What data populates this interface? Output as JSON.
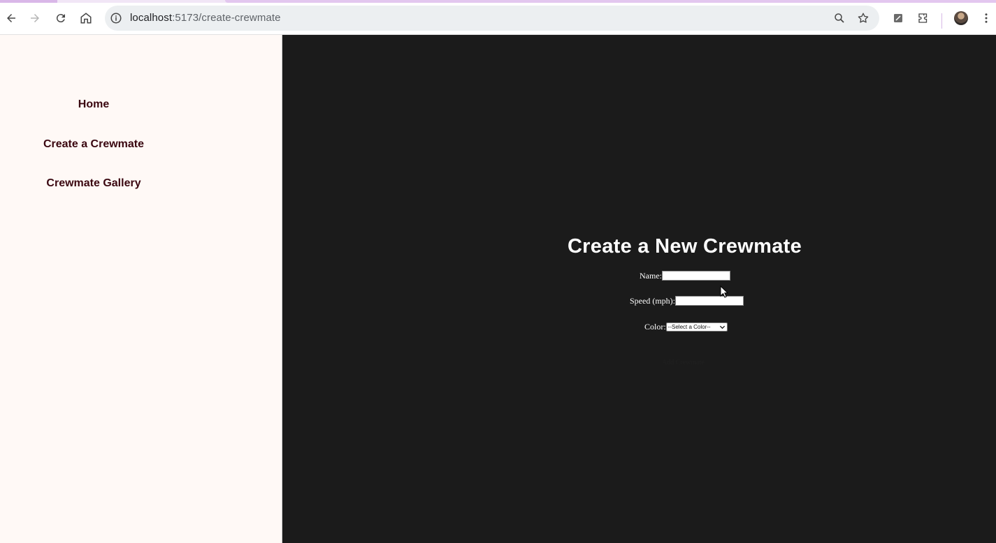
{
  "browser": {
    "url_host": "localhost",
    "url_path": ":5173/create-crewmate",
    "icons": [
      "back-icon",
      "forward-icon",
      "reload-icon",
      "home-icon",
      "info-icon",
      "zoom-icon",
      "star-icon",
      "extension-icon",
      "puzzle-icon",
      "avatar",
      "more-icon"
    ]
  },
  "sidebar": {
    "items": [
      {
        "label": "Home"
      },
      {
        "label": "Create a Crewmate"
      },
      {
        "label": "Crewmate Gallery"
      }
    ]
  },
  "form": {
    "title": "Create a New Crewmate",
    "name_label": "Name:",
    "name_value": "",
    "speed_label": "Speed (mph):",
    "speed_value": "",
    "color_label": "Color:",
    "color_selected": "--Select a Color--",
    "submit_label": "Add Crewmate"
  },
  "colors": {
    "sidebar_bg": "#fff9f6",
    "nav_text": "#3a0710",
    "main_bg": "#1b1b1b",
    "title_text": "#ffffff"
  }
}
